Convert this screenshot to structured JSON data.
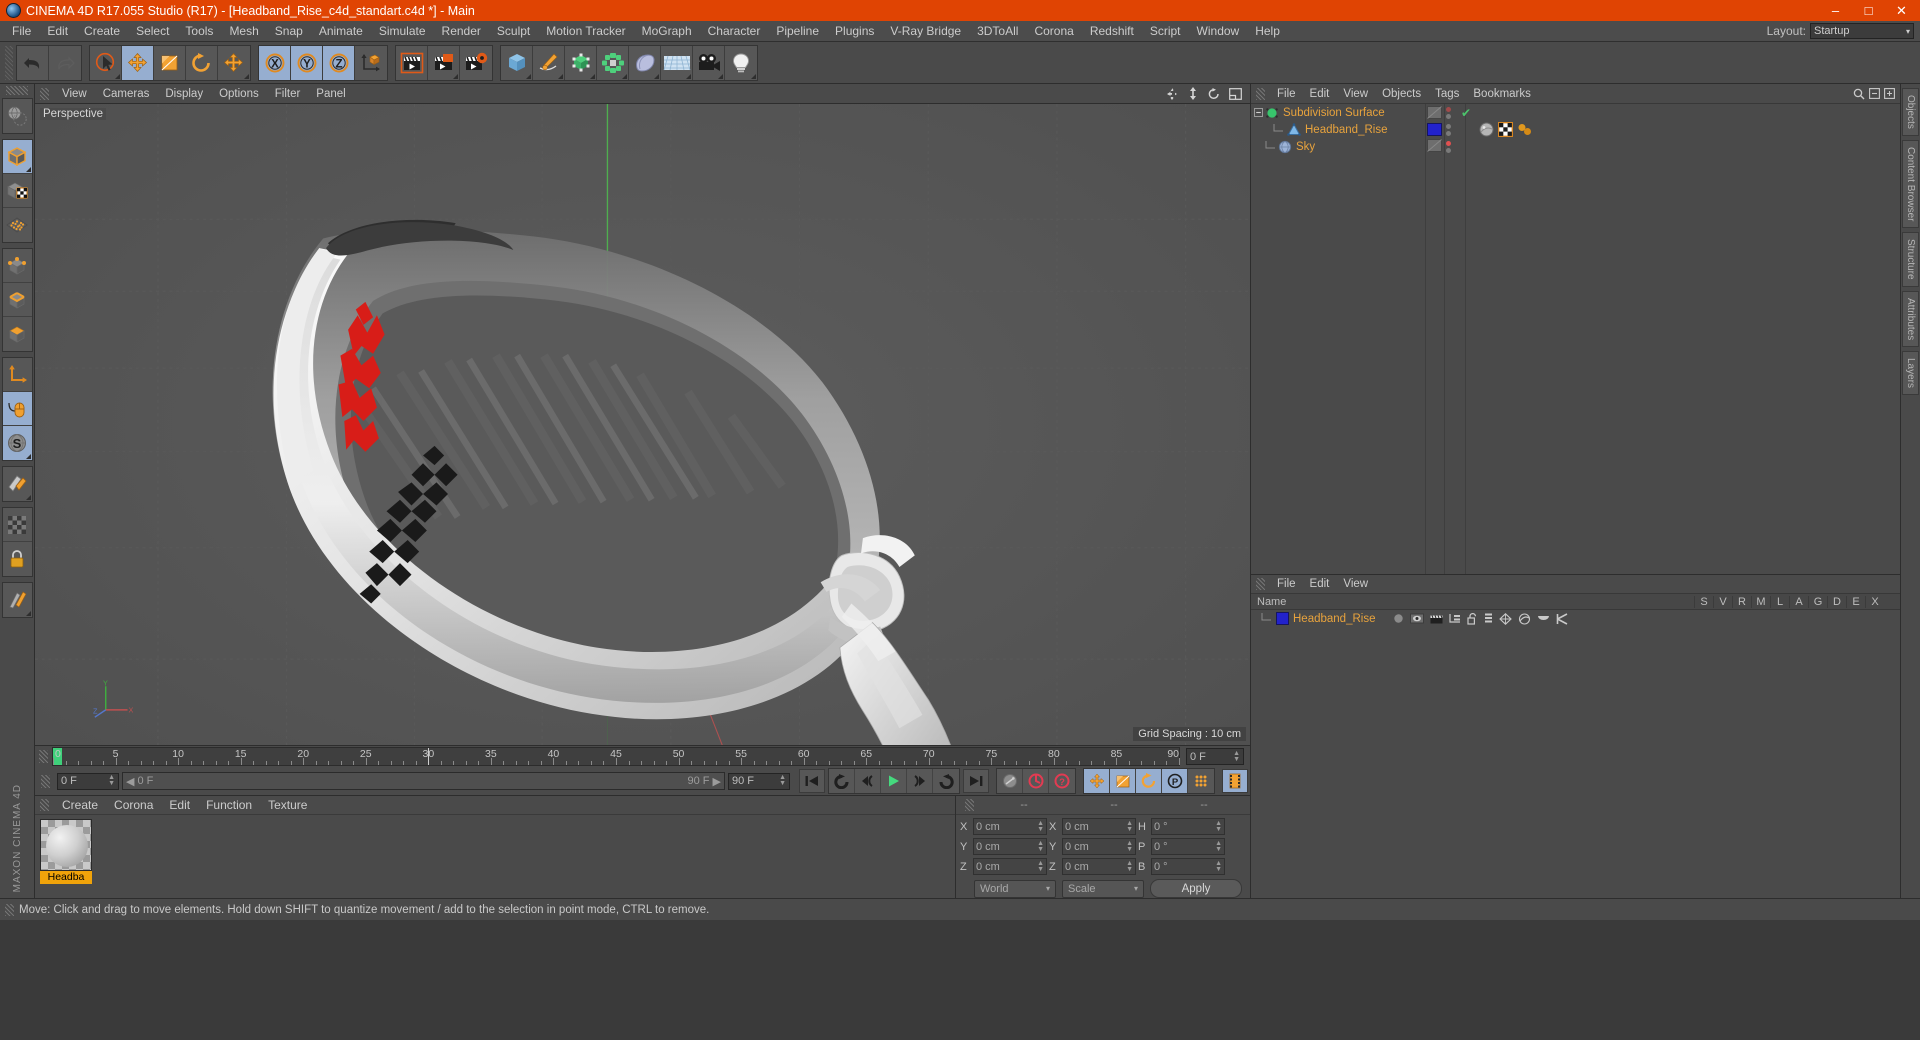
{
  "titlebar": {
    "title": "CINEMA 4D R17.055 Studio (R17) - [Headband_Rise_c4d_standart.c4d *] - Main",
    "logo_icon": "c4d-logo-icon",
    "minimize": "–",
    "maximize": "□",
    "close": "✕",
    "bg_color": "#e04403"
  },
  "menubar": {
    "items": [
      {
        "label": "File"
      },
      {
        "label": "Edit"
      },
      {
        "label": "Create"
      },
      {
        "label": "Select"
      },
      {
        "label": "Tools"
      },
      {
        "label": "Mesh"
      },
      {
        "label": "Snap"
      },
      {
        "label": "Animate"
      },
      {
        "label": "Simulate"
      },
      {
        "label": "Render"
      },
      {
        "label": "Sculpt"
      },
      {
        "label": "Motion Tracker"
      },
      {
        "label": "MoGraph"
      },
      {
        "label": "Character"
      },
      {
        "label": "Pipeline"
      },
      {
        "label": "Plugins"
      },
      {
        "label": "V-Ray Bridge"
      },
      {
        "label": "3DToAll"
      },
      {
        "label": "Corona"
      },
      {
        "label": "Redshift"
      },
      {
        "label": "Script"
      },
      {
        "label": "Window"
      },
      {
        "label": "Help"
      }
    ],
    "layout_label": "Layout:",
    "layout_value": "Startup",
    "layout_caret": "▾"
  },
  "toolbar": {
    "groups": [
      {
        "name": "history",
        "buttons": [
          {
            "name": "undo-button",
            "icon": "undo-icon",
            "active": false
          },
          {
            "name": "redo-button",
            "icon": "redo-icon",
            "active": false,
            "disabled": true
          }
        ]
      },
      {
        "name": "transform",
        "buttons": [
          {
            "name": "live-selection-button",
            "icon": "cursor-select-icon",
            "active": false,
            "corner": true
          },
          {
            "name": "move-tool-button",
            "icon": "move-icon",
            "active": true
          },
          {
            "name": "scale-tool-button",
            "icon": "scale-icon",
            "active": false
          },
          {
            "name": "rotate-tool-button",
            "icon": "rotate-icon",
            "active": false
          },
          {
            "name": "dynamic-place-button",
            "icon": "move-icon",
            "active": false,
            "corner": true
          }
        ]
      },
      {
        "name": "axis-lock",
        "buttons": [
          {
            "name": "lock-x-button",
            "icon": "axis-x-icon",
            "active": true
          },
          {
            "name": "lock-y-button",
            "icon": "axis-y-icon",
            "active": true
          },
          {
            "name": "lock-z-button",
            "icon": "axis-z-icon",
            "active": true
          },
          {
            "name": "world-object-coords-button",
            "icon": "world-coord-icon",
            "active": false
          }
        ]
      },
      {
        "name": "render",
        "buttons": [
          {
            "name": "render-view-button",
            "icon": "render-view-icon",
            "active": false
          },
          {
            "name": "render-region-button",
            "icon": "render-region-icon",
            "active": false,
            "corner": true
          },
          {
            "name": "render-settings-button",
            "icon": "render-settings-icon",
            "active": false
          }
        ]
      },
      {
        "name": "objects",
        "buttons": [
          {
            "name": "add-cube-button",
            "icon": "cube-icon",
            "active": false,
            "corner": true
          },
          {
            "name": "add-spline-button",
            "icon": "pen-spline-icon",
            "active": false,
            "corner": true
          },
          {
            "name": "add-generator-button",
            "icon": "nurbs-generator-icon",
            "active": false,
            "corner": true
          },
          {
            "name": "add-deformer-button",
            "icon": "deformer-icon",
            "active": false,
            "corner": true
          },
          {
            "name": "add-scene-object-button",
            "icon": "bend-object-icon",
            "active": false,
            "corner": true
          },
          {
            "name": "add-floor-button",
            "icon": "floor-grid-icon",
            "active": false,
            "corner": true
          },
          {
            "name": "add-camera-button",
            "icon": "camera-icon",
            "active": false,
            "corner": true
          },
          {
            "name": "add-light-button",
            "icon": "light-bulb-icon",
            "active": false,
            "corner": true
          }
        ]
      }
    ]
  },
  "leftbar": {
    "groups": [
      {
        "buttons": [
          {
            "name": "make-editable-button",
            "icon": "globe-editable-icon",
            "active": false
          }
        ]
      },
      {
        "buttons": [
          {
            "name": "model-mode-button",
            "icon": "model-cube-icon",
            "active": true,
            "corner": true
          },
          {
            "name": "texture-mode-button",
            "icon": "texture-cube-icon",
            "active": false
          },
          {
            "name": "workplane-mode-button",
            "icon": "workplane-icon",
            "active": false
          }
        ]
      },
      {
        "buttons": [
          {
            "name": "points-mode-button",
            "icon": "points-cube-icon",
            "active": false
          },
          {
            "name": "edges-mode-button",
            "icon": "edges-cube-icon",
            "active": false
          },
          {
            "name": "polygons-mode-button",
            "icon": "polygons-cube-icon",
            "active": false
          }
        ]
      },
      {
        "buttons": [
          {
            "name": "object-axis-mode-button",
            "icon": "axis-arrow-icon",
            "active": false
          },
          {
            "name": "enable-snap-button",
            "icon": "mouse-snap-icon",
            "active": true
          },
          {
            "name": "scale-snap-button",
            "icon": "s-circle-icon",
            "active": true,
            "corner": true
          }
        ]
      },
      {
        "buttons": [
          {
            "name": "knife-tool-button",
            "icon": "knife-icon",
            "active": false,
            "corner": true
          }
        ]
      },
      {
        "buttons": [
          {
            "name": "viewport-solo-button",
            "icon": "checker-solo-icon",
            "active": false
          },
          {
            "name": "lock-selection-button",
            "icon": "lock-icon",
            "active": false
          }
        ]
      },
      {
        "buttons": [
          {
            "name": "deformer-toggle-button",
            "icon": "deform-toggle-icon",
            "active": false,
            "corner": true
          }
        ]
      }
    ],
    "brand": "MAXON CINEMA 4D"
  },
  "viewport": {
    "menu_items": [
      {
        "label": "View"
      },
      {
        "label": "Cameras"
      },
      {
        "label": "Display"
      },
      {
        "label": "Options"
      },
      {
        "label": "Filter"
      },
      {
        "label": "Panel"
      }
    ],
    "label": "Perspective",
    "grid_spacing": "Grid Spacing : 10 cm",
    "nav_icons": [
      "pan-icon",
      "dolly-icon",
      "rotate-view-icon",
      "maximize-view-icon"
    ],
    "axis_labels": {
      "y": "Y",
      "x": "X",
      "z": "Z"
    },
    "background_color": "#545454",
    "model_description": "White headband with red and black embroidered folk pattern, tied knot on right side"
  },
  "timeline": {
    "ticks": [
      0,
      5,
      10,
      15,
      20,
      25,
      30,
      35,
      40,
      45,
      50,
      55,
      60,
      65,
      70,
      75,
      80,
      85,
      90
    ],
    "current_frame_marker": 0,
    "playhead_frame": 30,
    "left_field": "0 F",
    "range_start": "0 F",
    "range_end": "90 F",
    "right_field_top": "0 F",
    "current_frame_field": "0 F",
    "end_frame_field": "90 F",
    "transport": [
      {
        "name": "goto-start-button",
        "icon": "skip-start-icon"
      },
      {
        "name": "play-backward-loop-button",
        "icon": "loop-back-icon"
      },
      {
        "name": "step-back-button",
        "icon": "prev-frame-icon"
      },
      {
        "name": "play-button",
        "icon": "play-icon"
      },
      {
        "name": "step-forward-button",
        "icon": "next-frame-icon"
      },
      {
        "name": "play-forward-loop-button",
        "icon": "loop-forward-icon"
      },
      {
        "name": "goto-end-button",
        "icon": "skip-end-icon"
      }
    ],
    "record_group": [
      {
        "name": "autokeying-button",
        "icon": "autokey-icon",
        "state": "off"
      },
      {
        "name": "record-active-objects-button",
        "icon": "record-icon",
        "state": "on"
      },
      {
        "name": "keyframe-selection-button",
        "icon": "key-selection-icon",
        "state": "on"
      }
    ],
    "key_toggles": [
      {
        "name": "key-position-button",
        "icon": "move-icon",
        "active": true
      },
      {
        "name": "key-scale-button",
        "icon": "scale-icon",
        "active": true
      },
      {
        "name": "key-rotation-button",
        "icon": "rotate-icon",
        "active": true
      },
      {
        "name": "key-parameter-button",
        "icon": "p-circle-icon",
        "active": true
      },
      {
        "name": "key-pla-button",
        "icon": "pla-dots-icon",
        "active": false
      },
      {
        "name": "timeline-filmstrip-button",
        "icon": "filmstrip-icon",
        "active": true
      }
    ]
  },
  "material_manager": {
    "menu_items": [
      {
        "label": "Create"
      },
      {
        "label": "Corona"
      },
      {
        "label": "Edit"
      },
      {
        "label": "Function"
      },
      {
        "label": "Texture"
      }
    ],
    "materials": [
      {
        "name": "Headba",
        "selected": true,
        "preview_icon": "material-sphere-icon"
      }
    ]
  },
  "coordinates_manager": {
    "headers": [
      "--",
      "--",
      "--"
    ],
    "rows": [
      {
        "pos_label": "X",
        "pos_value": "0 cm",
        "size_label": "X",
        "size_value": "0 cm",
        "rot_label": "H",
        "rot_value": "0 °"
      },
      {
        "pos_label": "Y",
        "pos_value": "0 cm",
        "size_label": "Y",
        "size_value": "0 cm",
        "rot_label": "P",
        "rot_value": "0 °"
      },
      {
        "pos_label": "Z",
        "pos_value": "0 cm",
        "size_label": "Z",
        "size_value": "0 cm",
        "rot_label": "B",
        "rot_value": "0 °"
      }
    ],
    "coord_system": "World",
    "transform_mode": "Scale",
    "apply_label": "Apply",
    "caret": "▾"
  },
  "object_manager": {
    "menu_items": [
      {
        "label": "File"
      },
      {
        "label": "Edit"
      },
      {
        "label": "View"
      },
      {
        "label": "Objects"
      },
      {
        "label": "Tags"
      },
      {
        "label": "Bookmarks"
      }
    ],
    "search_icon": "search-icon",
    "objects": [
      {
        "name": "Subdivision Surface",
        "icon": "subdivision-surface-icon",
        "depth": 0,
        "editor_dot": "#c05050",
        "render_check": "✔",
        "expandable": true,
        "tags": []
      },
      {
        "name": "Headband_Rise",
        "icon": "polygon-object-icon",
        "depth": 1,
        "layer_color": "#2222cc",
        "tags": [
          "material-tag-icon",
          "uvw-tag-icon",
          "corona-tag-icon"
        ]
      },
      {
        "name": "Sky",
        "icon": "sky-object-icon",
        "depth": 0,
        "editor_dot": "#e05050",
        "tags": []
      }
    ]
  },
  "object_manager_2": {
    "menu_items": [
      {
        "label": "File"
      },
      {
        "label": "Edit"
      },
      {
        "label": "View"
      }
    ],
    "columns": [
      "Name",
      "S",
      "V",
      "R",
      "M",
      "L",
      "A",
      "G",
      "D",
      "E",
      "X"
    ],
    "rows": [
      {
        "name": "Headband_Rise",
        "color": "#2222cc",
        "cells": [
          "dot-icon",
          "eye-icon",
          "render-icon",
          "mesh-icon",
          "unlock-icon",
          "anim-icon",
          "generator-icon",
          "deform-icon",
          "expression-icon",
          "xpresso-icon"
        ]
      }
    ]
  },
  "right_tabs": [
    {
      "label": "Objects",
      "name": "tab-objects"
    },
    {
      "label": "Content Browser",
      "name": "tab-content-browser"
    },
    {
      "label": "Structure",
      "name": "tab-structure"
    },
    {
      "label": "Attributes",
      "name": "tab-attributes"
    },
    {
      "label": "Layers",
      "name": "tab-layers"
    }
  ],
  "statusbar": {
    "text": "Move: Click and drag to move elements. Hold down SHIFT to quantize movement / add to the selection in point mode, CTRL to remove."
  }
}
